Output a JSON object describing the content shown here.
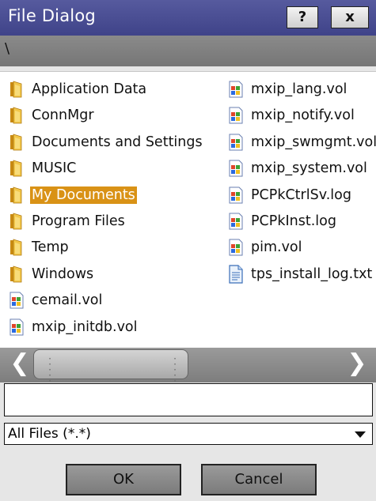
{
  "titlebar": {
    "title": "File Dialog",
    "help_label": "?",
    "close_label": "x"
  },
  "path": "\\",
  "files": {
    "col1": [
      {
        "label": "Application Data",
        "icon": "folder-icon",
        "selected": false
      },
      {
        "label": "ConnMgr",
        "icon": "folder-icon",
        "selected": false
      },
      {
        "label": "Documents and Settings",
        "icon": "folder-icon",
        "selected": false
      },
      {
        "label": "MUSIC",
        "icon": "folder-icon",
        "selected": false
      },
      {
        "label": "My Documents",
        "icon": "folder-icon",
        "selected": true
      },
      {
        "label": "Program Files",
        "icon": "folder-icon",
        "selected": false
      },
      {
        "label": "Temp",
        "icon": "folder-icon",
        "selected": false
      },
      {
        "label": "Windows",
        "icon": "folder-icon",
        "selected": false
      },
      {
        "label": "cemail.vol",
        "icon": "system-file-icon",
        "selected": false
      },
      {
        "label": "mxip_initdb.vol",
        "icon": "system-file-icon",
        "selected": false
      }
    ],
    "col2": [
      {
        "label": "mxip_lang.vol",
        "icon": "system-file-icon",
        "selected": false
      },
      {
        "label": "mxip_notify.vol",
        "icon": "system-file-icon",
        "selected": false
      },
      {
        "label": "mxip_swmgmt.vol",
        "icon": "system-file-icon",
        "selected": false
      },
      {
        "label": "mxip_system.vol",
        "icon": "system-file-icon",
        "selected": false
      },
      {
        "label": "PCPkCtrlSv.log",
        "icon": "system-file-icon",
        "selected": false
      },
      {
        "label": "PCPkInst.log",
        "icon": "system-file-icon",
        "selected": false
      },
      {
        "label": "pim.vol",
        "icon": "system-file-icon",
        "selected": false
      },
      {
        "label": "tps_install_log.txt",
        "icon": "text-file-icon",
        "selected": false
      }
    ]
  },
  "scrollbar": {
    "left_arrow": "❮",
    "right_arrow": "❯"
  },
  "filename_value": "",
  "filter": {
    "selected": "All Files (*.*)"
  },
  "buttons": {
    "ok_label": "OK",
    "cancel_label": "Cancel"
  },
  "colors": {
    "title_bar": "#4a4e92",
    "selection": "#d99216"
  }
}
